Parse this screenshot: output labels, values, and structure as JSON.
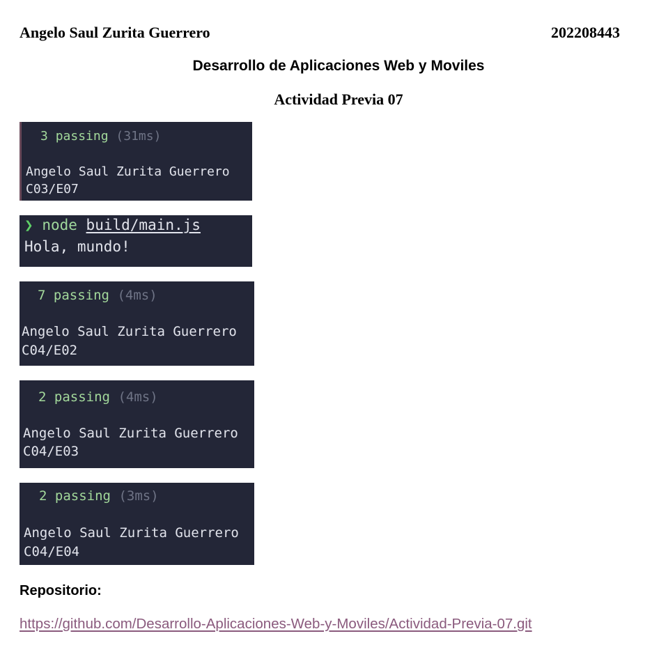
{
  "header": {
    "author": "Angelo Saul Zurita Guerrero",
    "student_id": "202208443",
    "course": "Desarrollo de Aplicaciones Web y Moviles",
    "activity": "Actividad Previa 07"
  },
  "screenshots": [
    {
      "passing_count": "3",
      "passing_word": "passing",
      "duration": "(31ms)",
      "name": "Angelo Saul Zurita Guerrero",
      "code": "C03/E07"
    },
    {
      "prompt_symbol": "❯",
      "command": "node",
      "argument": "build/main.js",
      "output": "Hola, mundo!"
    },
    {
      "passing_count": "7",
      "passing_word": "passing",
      "duration": "(4ms)",
      "name": "Angelo Saul Zurita Guerrero",
      "code": "C04/E02"
    },
    {
      "passing_count": "2",
      "passing_word": "passing",
      "duration": "(4ms)",
      "name": "Angelo Saul Zurita Guerrero",
      "code": "C04/E03"
    },
    {
      "passing_count": "2",
      "passing_word": "passing",
      "duration": "(3ms)",
      "name": "Angelo Saul Zurita Guerrero",
      "code": "C04/E04"
    }
  ],
  "repository": {
    "label": "Repositorio:",
    "url": "https://github.com/Desarrollo-Aplicaciones-Web-y-Moviles/Actividad-Previa-07.git"
  },
  "colors": {
    "terminal_bg": "#232637",
    "terminal_text": "#e2e4ec",
    "passing_green": "#a3d99b",
    "duration_gray": "#6f7486",
    "link": "#8a5a7d"
  }
}
